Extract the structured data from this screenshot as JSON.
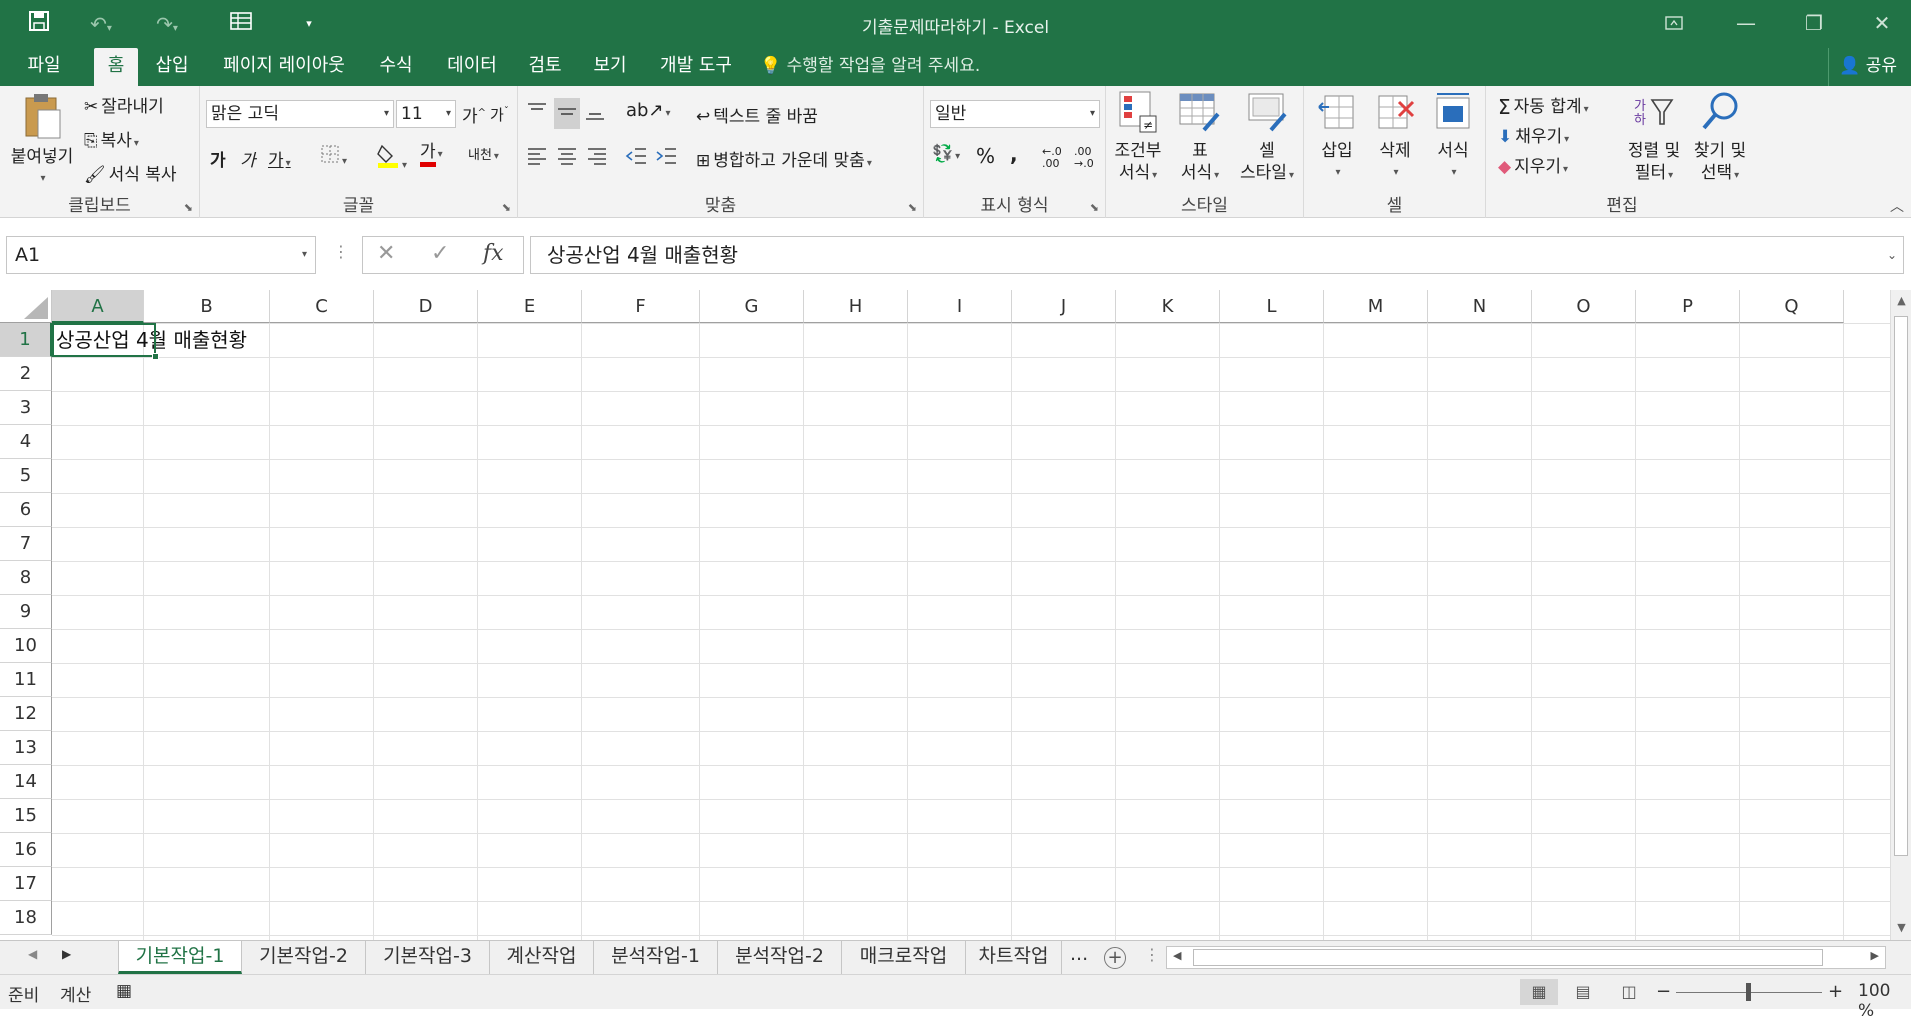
{
  "app": {
    "window_title": "기출문제따라하기 - Excel"
  },
  "quick_access": {
    "save_icon": "save-icon",
    "undo_icon": "undo-icon",
    "redo_icon": "redo-icon",
    "form_icon": "form-icon",
    "customize_icon": "customize-qat-icon"
  },
  "ribbon_tabs": [
    {
      "label": "파일"
    },
    {
      "label": "홈"
    },
    {
      "label": "삽입"
    },
    {
      "label": "페이지 레이아웃"
    },
    {
      "label": "수식"
    },
    {
      "label": "데이터"
    },
    {
      "label": "검토"
    },
    {
      "label": "보기"
    },
    {
      "label": "개발 도구"
    }
  ],
  "active_tab": "홈",
  "tell_me": "수행할 작업을 알려 주세요.",
  "share": "공유",
  "clipboard": {
    "paste": "붙여넣기",
    "cut": "잘라내기",
    "copy": "복사",
    "format_painter": "서식 복사",
    "group": "클립보드"
  },
  "font": {
    "name": "맑은 고딕",
    "size": "11",
    "grow": "가",
    "shrink": "가",
    "bold": "가",
    "italic": "가",
    "underline": "가",
    "font_color": "가",
    "phonetic": "내천",
    "group": "글꼴"
  },
  "alignment": {
    "wrap_text": "텍스트 줄 바꿈",
    "merge_center": "병합하고 가운데 맞춤",
    "group": "맞춤"
  },
  "number": {
    "format": "일반",
    "percent": "%",
    "comma": ",",
    "group": "표시 형식"
  },
  "styles": {
    "conditional_1": "조건부",
    "conditional_2": "서식",
    "table_1": "표",
    "table_2": "서식",
    "cell_1": "셀",
    "cell_2": "스타일",
    "group": "스타일"
  },
  "cells": {
    "insert": "삽입",
    "delete": "삭제",
    "format": "서식",
    "group": "셀"
  },
  "editing": {
    "autosum": "자동 합계",
    "fill": "채우기",
    "clear": "지우기",
    "sort_1": "정렬 및",
    "sort_2": "필터",
    "find_1": "찾기 및",
    "find_2": "선택",
    "group": "편집"
  },
  "formula_bar": {
    "name_box": "A1",
    "fx": "fx",
    "content": "상공산업 4월 매출현황"
  },
  "grid": {
    "columns": [
      "A",
      "B",
      "C",
      "D",
      "E",
      "F",
      "G",
      "H",
      "I",
      "J",
      "K",
      "L",
      "M",
      "N",
      "O",
      "P",
      "Q"
    ],
    "rows": [
      "1",
      "2",
      "3",
      "4",
      "5",
      "6",
      "7",
      "8",
      "9",
      "10",
      "11",
      "12",
      "13",
      "14",
      "15",
      "16",
      "17",
      "18"
    ],
    "selected_cell": "A1",
    "cell_A1": "상공산업 4월 매출현황"
  },
  "sheet_tabs": [
    {
      "label": "기본작업-1",
      "active": true
    },
    {
      "label": "기본작업-2"
    },
    {
      "label": "기본작업-3"
    },
    {
      "label": "계산작업"
    },
    {
      "label": "분석작업-1"
    },
    {
      "label": "분석작업-2"
    },
    {
      "label": "매크로작업"
    },
    {
      "label": "차트작업"
    }
  ],
  "sheet_more": "...",
  "status": {
    "ready": "준비",
    "calc": "계산",
    "zoom": "100 %"
  },
  "colors": {
    "brand": "#217346",
    "ribbon_bg": "#f3f3f3",
    "grid_line": "#e1e1e1"
  }
}
